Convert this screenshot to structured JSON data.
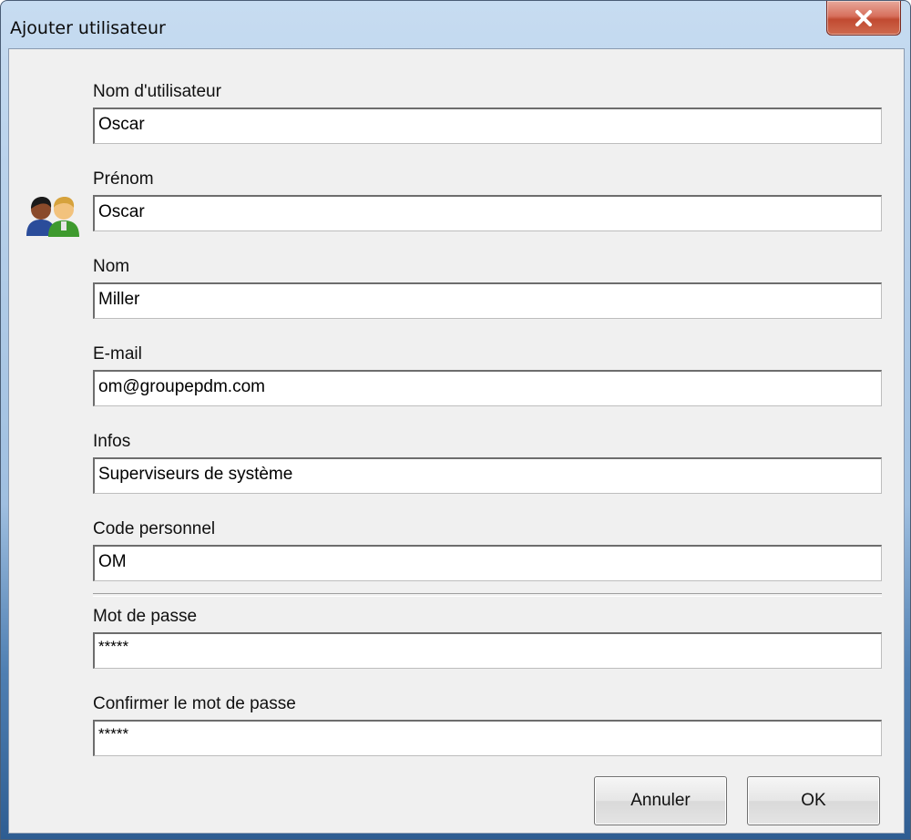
{
  "window": {
    "title": "Ajouter utilisateur",
    "close_icon": "close-icon",
    "user_icon": "users-icon"
  },
  "form": {
    "username": {
      "label": "Nom d'utilisateur",
      "value": "Oscar"
    },
    "first_name": {
      "label": "Prénom",
      "value": "Oscar"
    },
    "last_name": {
      "label": "Nom",
      "value": "Miller"
    },
    "email": {
      "label": "E-mail",
      "value": "om@groupepdm.com"
    },
    "info": {
      "label": "Infos",
      "value": "Superviseurs de système"
    },
    "personal_code": {
      "label": "Code personnel",
      "value": "OM"
    },
    "password": {
      "label": "Mot de passe",
      "value": "*****"
    },
    "confirm_password": {
      "label": "Confirmer le mot de passe",
      "value": "*****"
    }
  },
  "buttons": {
    "cancel": "Annuler",
    "ok": "OK"
  },
  "colors": {
    "close_button": "#c94f36",
    "dialog_background": "#f0f0f0",
    "title_glass": "#b3cde8"
  }
}
